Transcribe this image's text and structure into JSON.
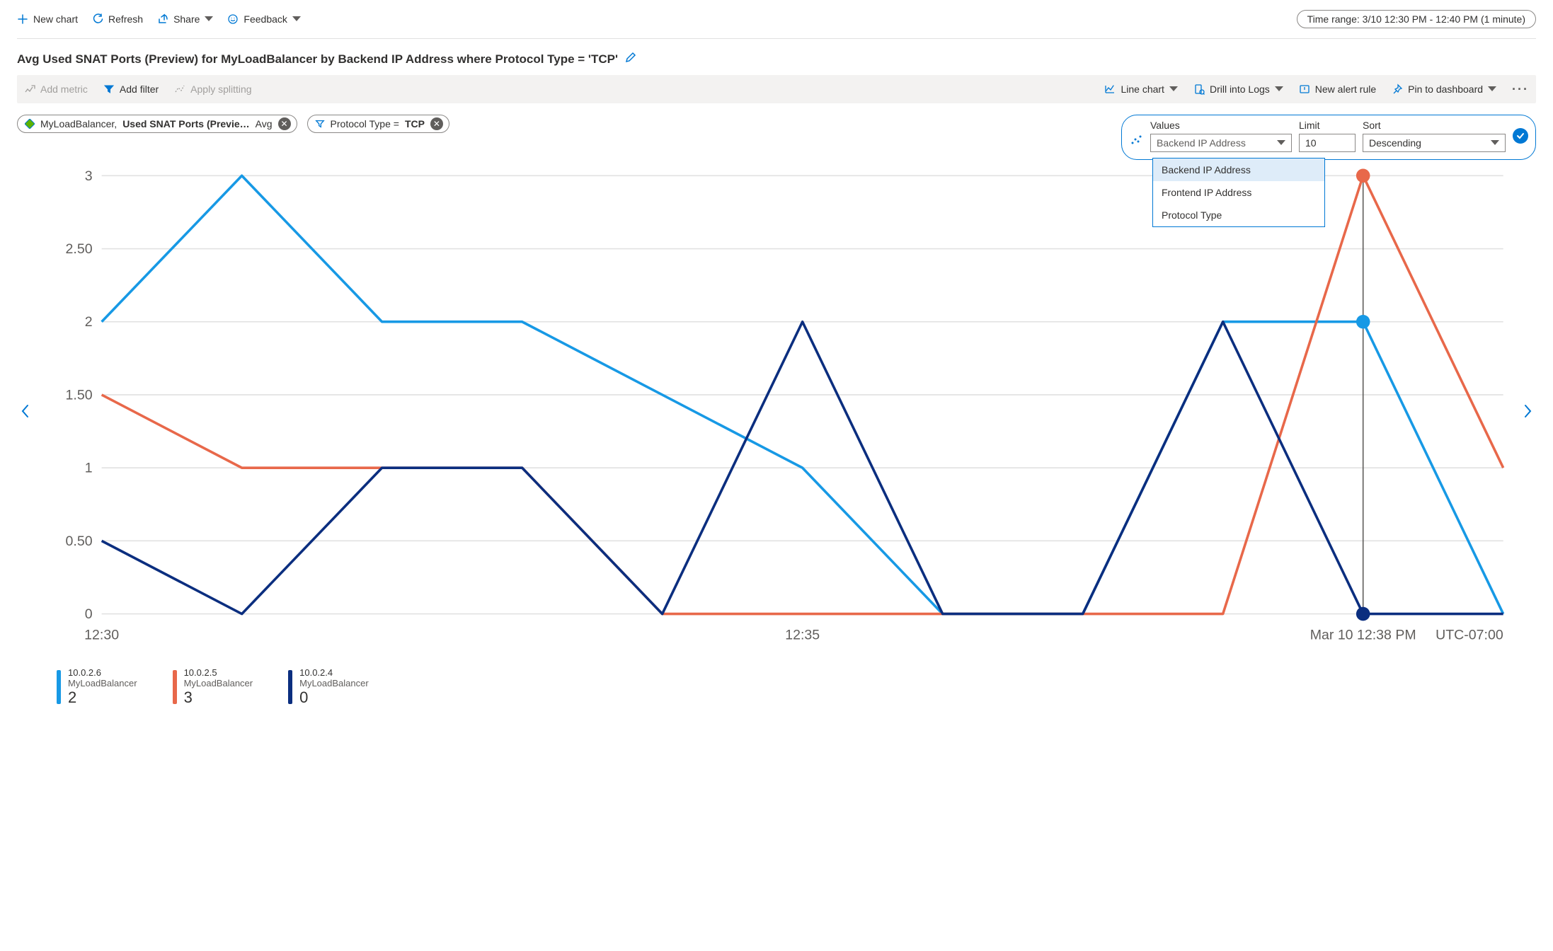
{
  "toolbar": {
    "new_chart": "New chart",
    "refresh": "Refresh",
    "share": "Share",
    "feedback": "Feedback",
    "time_range": "Time range: 3/10 12:30 PM - 12:40 PM (1 minute)"
  },
  "title": "Avg Used SNAT Ports (Preview) for MyLoadBalancer by Backend IP Address where Protocol Type = 'TCP'",
  "chartbar": {
    "add_metric": "Add metric",
    "add_filter": "Add filter",
    "apply_splitting": "Apply splitting",
    "chart_type": "Line chart",
    "drill_logs": "Drill into Logs",
    "new_alert": "New alert rule",
    "pin_dashboard": "Pin to dashboard"
  },
  "pills": {
    "metric_resource": "MyLoadBalancer,",
    "metric_name": "Used SNAT Ports (Previe…",
    "metric_agg": "Avg",
    "filter_label": "Protocol Type  =  ",
    "filter_value": "TCP"
  },
  "split": {
    "values_label": "Values",
    "values_selected": "Backend IP Address",
    "values_options": [
      "Backend IP Address",
      "Frontend IP Address",
      "Protocol Type"
    ],
    "limit_label": "Limit",
    "limit_value": "10",
    "sort_label": "Sort",
    "sort_value": "Descending"
  },
  "chart_data": {
    "type": "line",
    "ylim": [
      0,
      3
    ],
    "yticks": [
      0,
      0.5,
      1,
      1.5,
      2,
      2.5,
      3
    ],
    "ytick_labels": [
      "0",
      "0.50",
      "1",
      "1.50",
      "2",
      "2.50",
      "3"
    ],
    "x": [
      0,
      1,
      2,
      3,
      4,
      5,
      6,
      7,
      8,
      9,
      10
    ],
    "xtick_labels": {
      "0": "12:30",
      "5": "12:35"
    },
    "series": [
      {
        "name": "10.0.2.6",
        "resource": "MyLoadBalancer",
        "color": "#1799e5",
        "values": [
          2,
          3,
          2,
          2,
          1.5,
          1,
          0,
          0,
          2,
          2,
          0
        ],
        "current_at": 9
      },
      {
        "name": "10.0.2.5",
        "resource": "MyLoadBalancer",
        "color": "#e8684a",
        "values": [
          1.5,
          1,
          1,
          1,
          0,
          0,
          0,
          0,
          0,
          3,
          1
        ],
        "current_at": 9
      },
      {
        "name": "10.0.2.4",
        "resource": "MyLoadBalancer",
        "color": "#0b2e7f",
        "values": [
          0.5,
          0,
          1,
          1,
          0,
          2,
          0,
          0,
          2,
          0,
          0
        ],
        "current_at": 9
      }
    ],
    "marker_x": 9,
    "marker_label": "Mar 10 12:38 PM",
    "tz_label": "UTC-07:00"
  },
  "colors": {
    "accent": "#0078d4"
  }
}
